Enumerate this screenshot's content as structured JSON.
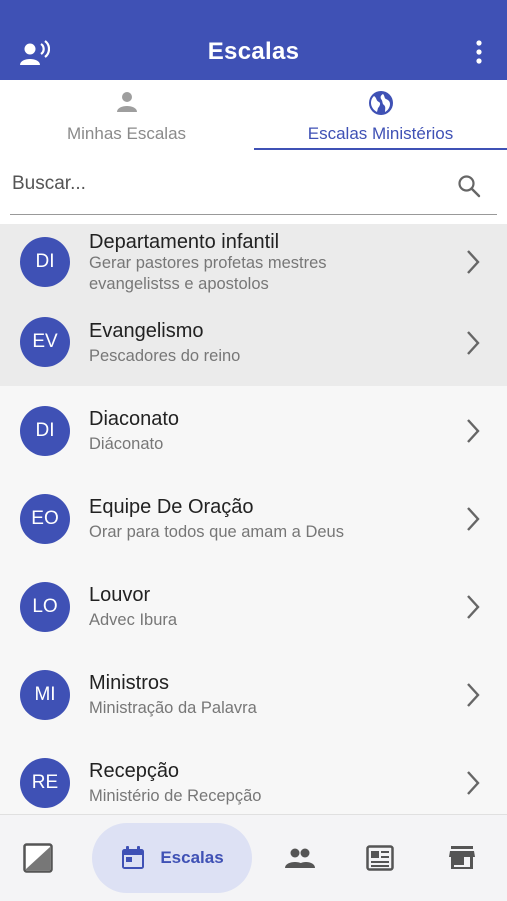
{
  "app_bar": {
    "title": "Escalas",
    "left_icon": "person-voice-icon",
    "right_icon": "more-vert-icon",
    "color": "#3f51b5"
  },
  "tabs": [
    {
      "label": "Minhas Escalas",
      "icon": "person-icon",
      "active": false
    },
    {
      "label": "Escalas Ministérios",
      "icon": "globe-icon",
      "active": true
    }
  ],
  "search": {
    "placeholder": "Buscar...",
    "value": ""
  },
  "ministries": [
    {
      "initials": "DI",
      "title": "Departamento infantil",
      "subtitle": "Gerar pastores profetas mestres evangelistss e apostolos"
    },
    {
      "initials": "EV",
      "title": "Evangelismo",
      "subtitle": "Pescadores do reino"
    },
    {
      "initials": "DI",
      "title": "Diaconato",
      "subtitle": "Diáconato"
    },
    {
      "initials": "EO",
      "title": "Equipe De Oração",
      "subtitle": "Orar para todos que amam a Deus"
    },
    {
      "initials": "LO",
      "title": "Louvor",
      "subtitle": "Advec Ibura"
    },
    {
      "initials": "MI",
      "title": "Ministros",
      "subtitle": "Ministração da Palavra"
    },
    {
      "initials": "RE",
      "title": "Recepção",
      "subtitle": "Ministério de Recepção"
    }
  ],
  "bottom_nav": {
    "items": [
      {
        "icon": "chart-icon"
      },
      {
        "icon": "calendar-icon",
        "label": "Escalas",
        "active": true
      },
      {
        "icon": "people-icon"
      },
      {
        "icon": "newspaper-icon"
      },
      {
        "icon": "store-icon"
      }
    ]
  }
}
